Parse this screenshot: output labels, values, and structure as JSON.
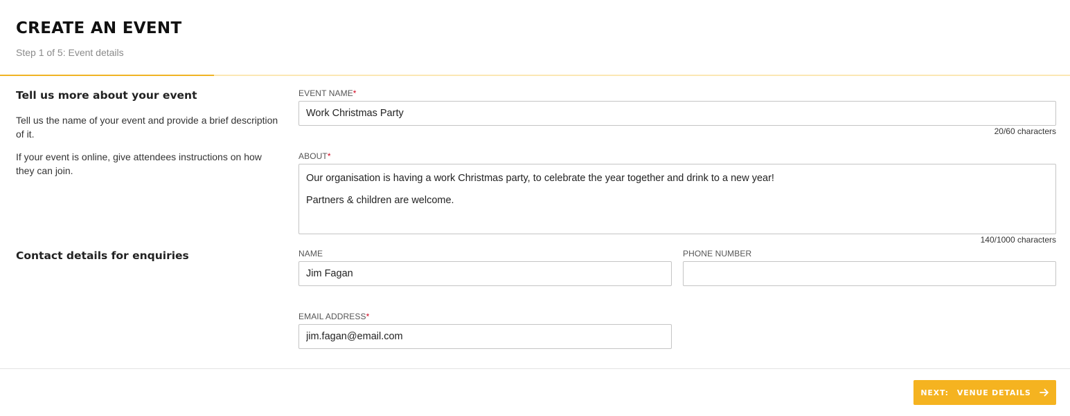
{
  "header": {
    "title": "CREATE AN EVENT",
    "step": "Step 1 of 5: Event details",
    "progress_fraction": 0.2
  },
  "sections": {
    "event": {
      "heading": "Tell us more about your event",
      "desc1": "Tell us the name of your event and provide a brief description of it.",
      "desc2": "If your event is online, give attendees instructions on how they can join."
    },
    "contact": {
      "heading": "Contact details for enquiries"
    }
  },
  "fields": {
    "event_name": {
      "label": "EVENT NAME",
      "required_mark": "*",
      "value": "Work Christmas Party",
      "counter": "20/60 characters"
    },
    "about": {
      "label": "ABOUT",
      "required_mark": "*",
      "lines": [
        "Our organisation is having a work Christmas party, to celebrate the year together and drink to a new year!",
        "Partners & children are welcome."
      ],
      "counter": "140/1000 characters"
    },
    "name": {
      "label": "NAME",
      "value": "Jim Fagan"
    },
    "phone": {
      "label": "PHONE NUMBER",
      "value": ""
    },
    "email": {
      "label": "EMAIL ADDRESS",
      "required_mark": "*",
      "value": "jim.fagan@email.com"
    }
  },
  "footer": {
    "next_prefix": "NEXT:",
    "next_label": "VENUE DETAILS",
    "next_icon": "arrow-right-icon"
  },
  "colors": {
    "accent": "#f5b320",
    "required": "#d0021b",
    "progress_track": "#fbe7b3"
  }
}
